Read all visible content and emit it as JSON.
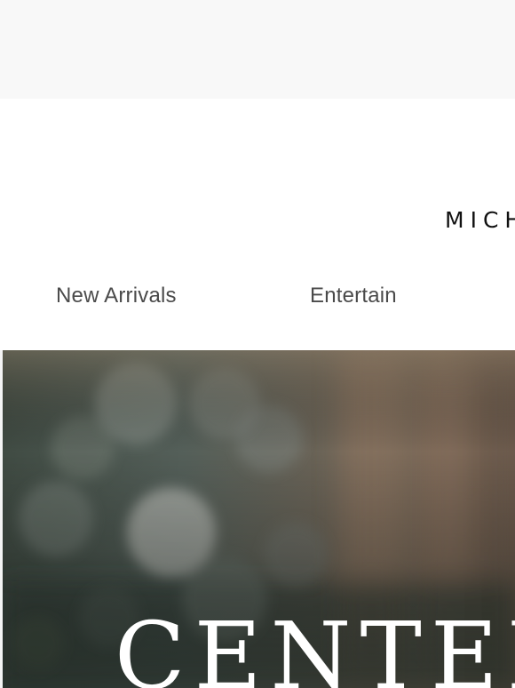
{
  "brand": {
    "name": "MICHAEL ARAM"
  },
  "nav": {
    "items": [
      {
        "label": "New Arrivals"
      },
      {
        "label": "Entertain"
      }
    ]
  },
  "hero": {
    "title": "CENTERPIECE",
    "image": "blurred-bokeh-photo"
  },
  "colors": {
    "preheader_bg": "#f8f8f8",
    "nav_text": "#4a4a4a",
    "brand_text": "#111111",
    "hero_text": "#ffffff"
  }
}
